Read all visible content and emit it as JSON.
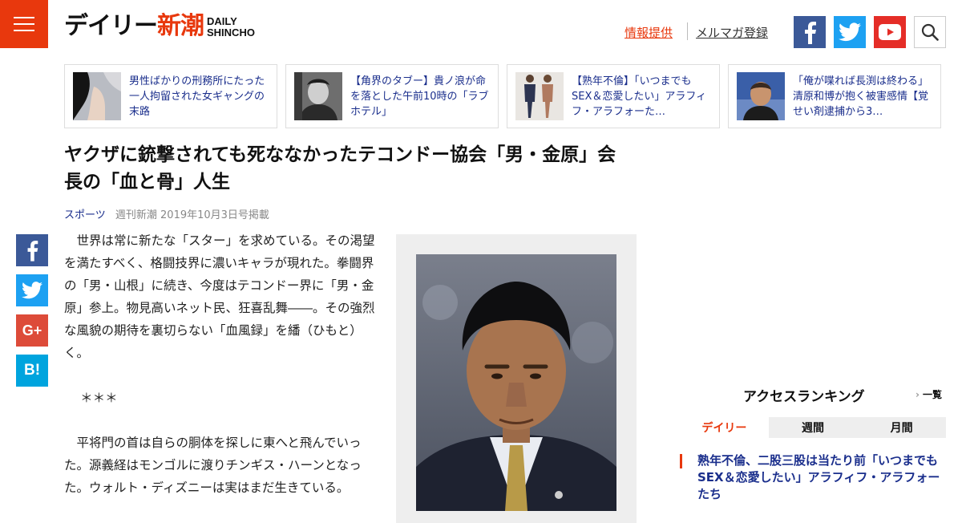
{
  "header": {
    "logo_jp_black": "デイリー",
    "logo_jp_accent": "新潮",
    "logo_en_1": "DAILY",
    "logo_en_2": "SHINCHO",
    "info_link": "情報提供",
    "mail_link": "メルマガ登録"
  },
  "icons": {
    "menu": "hamburger-icon",
    "facebook": "facebook-icon",
    "twitter": "twitter-icon",
    "youtube": "youtube-icon",
    "search": "search-icon"
  },
  "related": [
    {
      "text": "男性ばかりの刑務所にたった一人拘留された女ギャングの末路"
    },
    {
      "text": "【角界のタブー】貴ノ浪が命を落とした午前10時の「ラブホテル」"
    },
    {
      "text": "【熟年不倫】「いつまでもSEX＆恋愛したい」アラフィフ・アラフォーた…"
    },
    {
      "text": "「俺が喋れば長渕は終わる」清原和博が抱く被害感情【覚せい剤逮捕から3…"
    }
  ],
  "article": {
    "title": "ヤクザに銃撃されても死ななかったテコンドー協会「男・金原」会長の「血と骨」人生",
    "category": "スポーツ",
    "published": "週刊新潮 2019年10月3日号掲載",
    "p1": "世界は常に新たな「スター」を求めている。その渇望を満たすべく、格闘技界に濃いキャラが現れた。拳闘界の「男・山根」に続き、今度はテコンドー界に「男・金原」参上。物見高いネット民、狂喜乱舞――。その強烈な風貌の期待を裏切らない「血風録」を繙（ひもと）く。",
    "p2": "＊＊＊",
    "p3": "平将門の首は自らの胴体を探しに東へと飛んでいった。源義経はモンゴルに渡りチンギス・ハーンとなった。ウォルト・ディズニーは実はまだ生きている。"
  },
  "share": {
    "googleplus": "G+",
    "hatena": "B!"
  },
  "ranking": {
    "title": "アクセスランキング",
    "all_link": "一覧",
    "tabs": [
      "デイリー",
      "週間",
      "月間"
    ],
    "item1": "熟年不倫、二股三股は当たり前「いつまでもSEX＆恋愛したい」アラフィフ・アラフォーたち"
  },
  "colors": {
    "brand": "#e8380d",
    "link": "#1a2e8c",
    "facebook": "#3b5998",
    "twitter": "#1da1f2",
    "youtube": "#e52d27"
  }
}
